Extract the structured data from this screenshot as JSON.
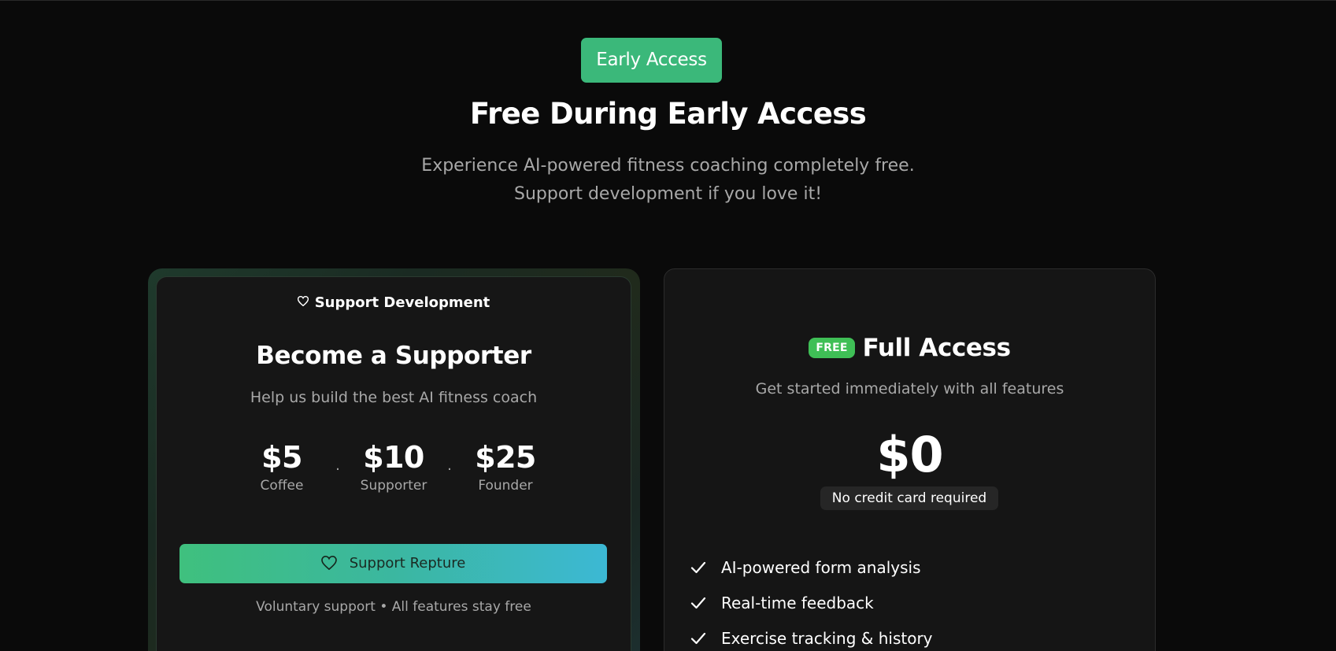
{
  "hero": {
    "badge": "Early Access",
    "title": "Free During Early Access",
    "subtitle_line1": "Experience AI-powered fitness coaching completely free.",
    "subtitle_line2": "Support development if you love it!"
  },
  "support_card": {
    "kicker_icon": "heart-icon",
    "kicker": "Support Development",
    "title": "Become a Supporter",
    "subtitle": "Help us build the best AI fitness coach",
    "tiers": [
      {
        "amount": "$5",
        "label": "Coffee"
      },
      {
        "amount": "$10",
        "label": "Supporter"
      },
      {
        "amount": "$25",
        "label": "Founder"
      }
    ],
    "separator": ".",
    "button_icon": "heart-icon",
    "button_label": "Support Repture",
    "note": "Voluntary support • All features stay free"
  },
  "access_card": {
    "pill": "FREE",
    "title": "Full Access",
    "subtitle": "Get started immediately with all features",
    "price": "$0",
    "price_note": "No credit card required",
    "features": [
      "AI-powered form analysis",
      "Real-time feedback",
      "Exercise tracking & history"
    ],
    "feature_icon": "check-icon"
  },
  "colors": {
    "background": "#0a0a0a",
    "accent_green": "#3bb87a",
    "free_pill": "#3fbf56",
    "gradient_start": "#3fc07e",
    "gradient_end": "#3cb8d4"
  }
}
